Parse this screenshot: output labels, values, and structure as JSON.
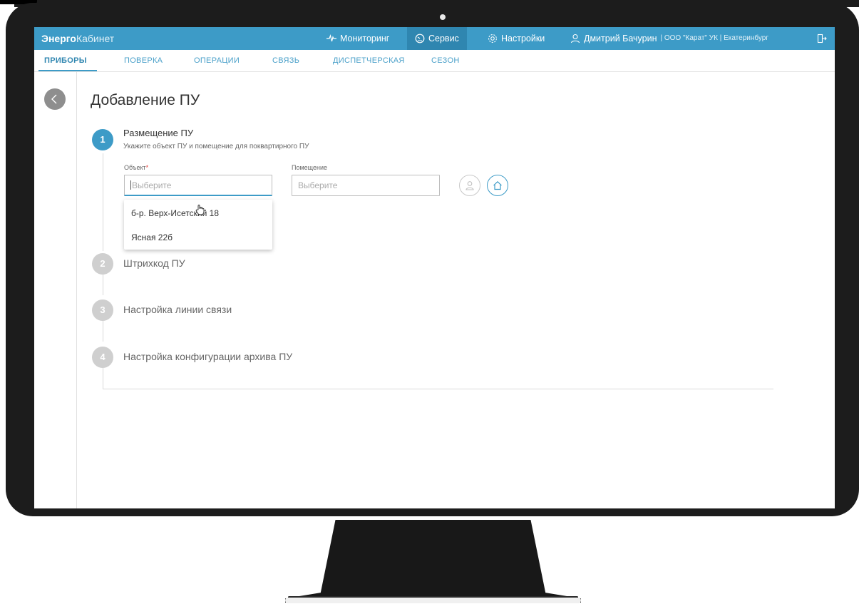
{
  "topbar": {
    "brand_bold": "Энерго",
    "brand_light": "Кабинет",
    "nav": [
      {
        "label": "Мониторинг",
        "icon": "pulse-icon"
      },
      {
        "label": "Сервис",
        "icon": "gauge-icon"
      },
      {
        "label": "Настройки",
        "icon": "gear-icon"
      }
    ],
    "user_name": "Дмитрий Бачурин",
    "user_org": "| ООО \"Карат\" УК | Екатеринбург"
  },
  "tabs": [
    "ПРИБОРЫ",
    "ПОВЕРКА",
    "ОПЕРАЦИИ",
    "СВЯЗЬ",
    "ДИСПЕТЧЕРСКАЯ",
    "СЕЗОН"
  ],
  "page": {
    "title": "Добавление ПУ"
  },
  "steps": [
    {
      "number": "1",
      "title": "Размещение ПУ",
      "subtitle": "Укажите объект ПУ и помещение для поквартирного ПУ"
    },
    {
      "number": "2",
      "title": "Штрихкод ПУ"
    },
    {
      "number": "3",
      "title": "Настройка линии связи"
    },
    {
      "number": "4",
      "title": "Настройка конфигурации архива ПУ"
    }
  ],
  "form": {
    "object_label": "Объект",
    "object_required": "*",
    "object_placeholder": "Выберите",
    "room_label": "Помещение",
    "room_placeholder": "Выберите"
  },
  "dropdown": {
    "options": [
      "б-р. Верх-Исетский 18",
      "Ясная 22б"
    ]
  },
  "colors": {
    "accent": "#3d9bc7",
    "accent_dark": "#2f86b0",
    "inactive_step": "#cfcfcf"
  }
}
